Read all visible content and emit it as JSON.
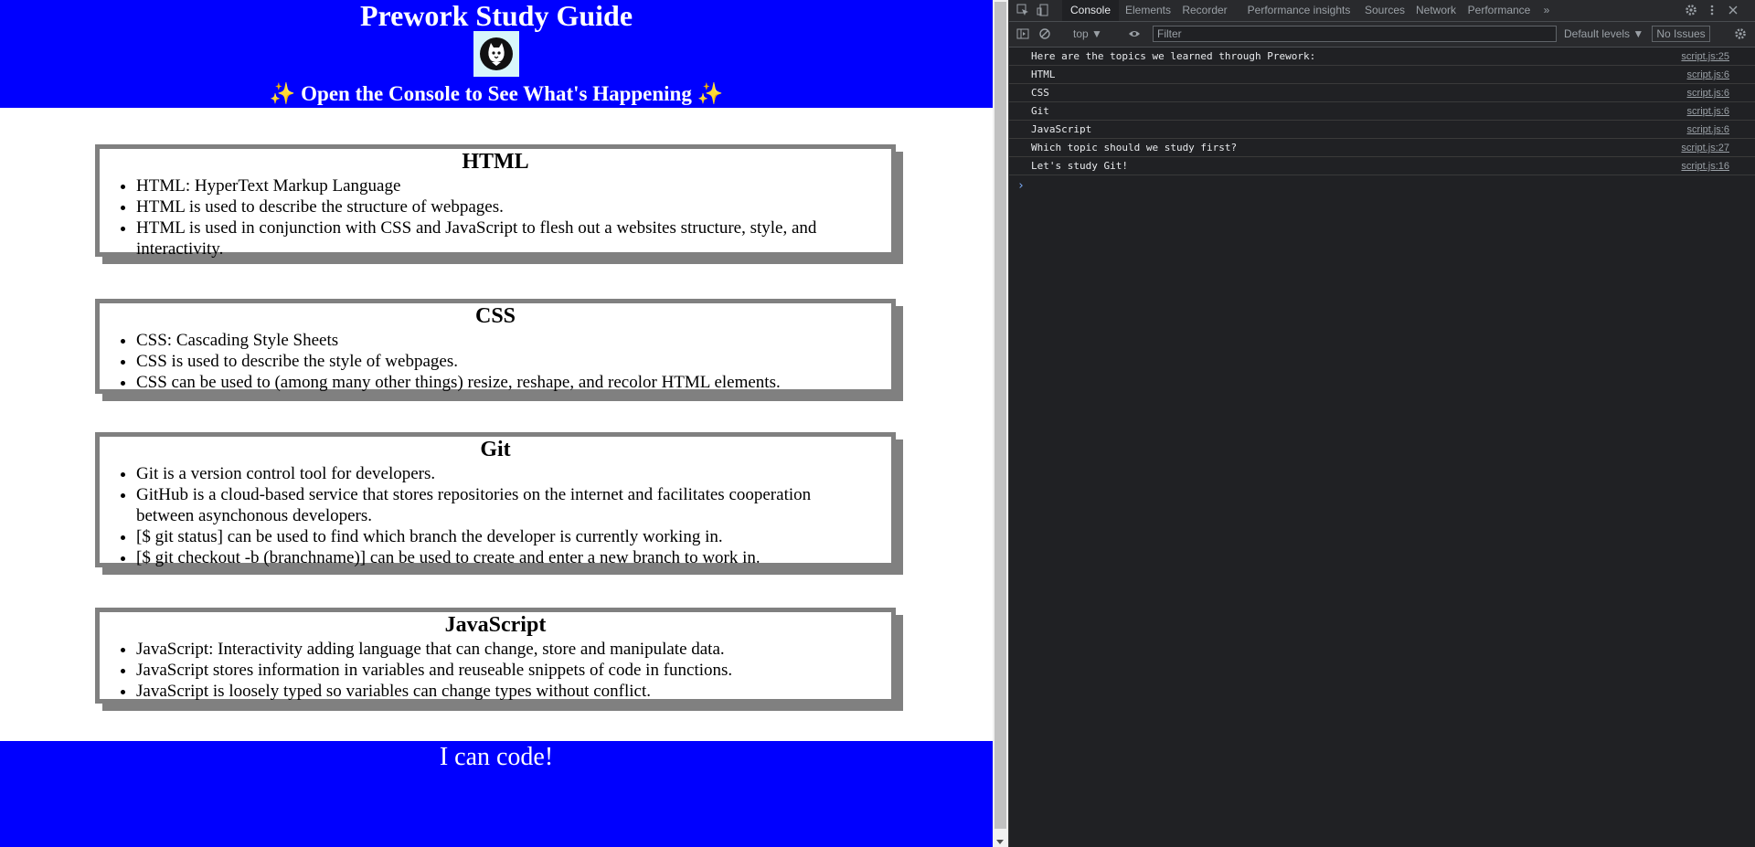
{
  "page": {
    "title": "Prework Study Guide",
    "subtitle": "✨ Open the Console to See What's Happening ✨",
    "footer": "I can code!",
    "colors": {
      "banner": "#0000ff",
      "card_border": "#808080"
    },
    "sections": [
      {
        "heading": "HTML",
        "items": [
          "HTML: HyperText Markup Language",
          "HTML is used to describe the structure of webpages.",
          "HTML is used in conjunction with CSS and JavaScript to flesh out a websites structure, style, and interactivity."
        ]
      },
      {
        "heading": "CSS",
        "items": [
          "CSS: Cascading Style Sheets",
          "CSS is used to describe the style of webpages.",
          "CSS can be used to (among many other things) resize, reshape, and recolor HTML elements."
        ]
      },
      {
        "heading": "Git",
        "items": [
          "Git is a version control tool for developers.",
          "GitHub is a cloud-based service that stores repositories on the internet and facilitates cooperation between asynchonous developers.",
          "[$ git status] can be used to find which branch the developer is currently working in.",
          "[$ git checkout -b (branchname)] can be used to create and enter a new branch to work in."
        ]
      },
      {
        "heading": "JavaScript",
        "items": [
          "JavaScript: Interactivity adding language that can change, store and manipulate data.",
          "JavaScript stores information in variables and reuseable snippets of code in functions.",
          "JavaScript is loosely typed so variables can change types without conflict."
        ]
      }
    ]
  },
  "devtools": {
    "tabs": [
      "Console",
      "Elements",
      "Recorder",
      "Performance insights",
      "Sources",
      "Network",
      "Performance"
    ],
    "context": "top ▼",
    "filter_placeholder": "Filter",
    "levels": "Default levels ▼",
    "issues": "No Issues",
    "console": [
      {
        "msg": "Here are the topics we learned through Prework:",
        "src": "script.js:25"
      },
      {
        "msg": "HTML",
        "src": "script.js:6"
      },
      {
        "msg": "CSS",
        "src": "script.js:6"
      },
      {
        "msg": "Git",
        "src": "script.js:6"
      },
      {
        "msg": "JavaScript",
        "src": "script.js:6"
      },
      {
        "msg": "Which topic should we study first?",
        "src": "script.js:27"
      },
      {
        "msg": "Let's study Git!",
        "src": "script.js:16"
      }
    ],
    "prompt": "›"
  }
}
